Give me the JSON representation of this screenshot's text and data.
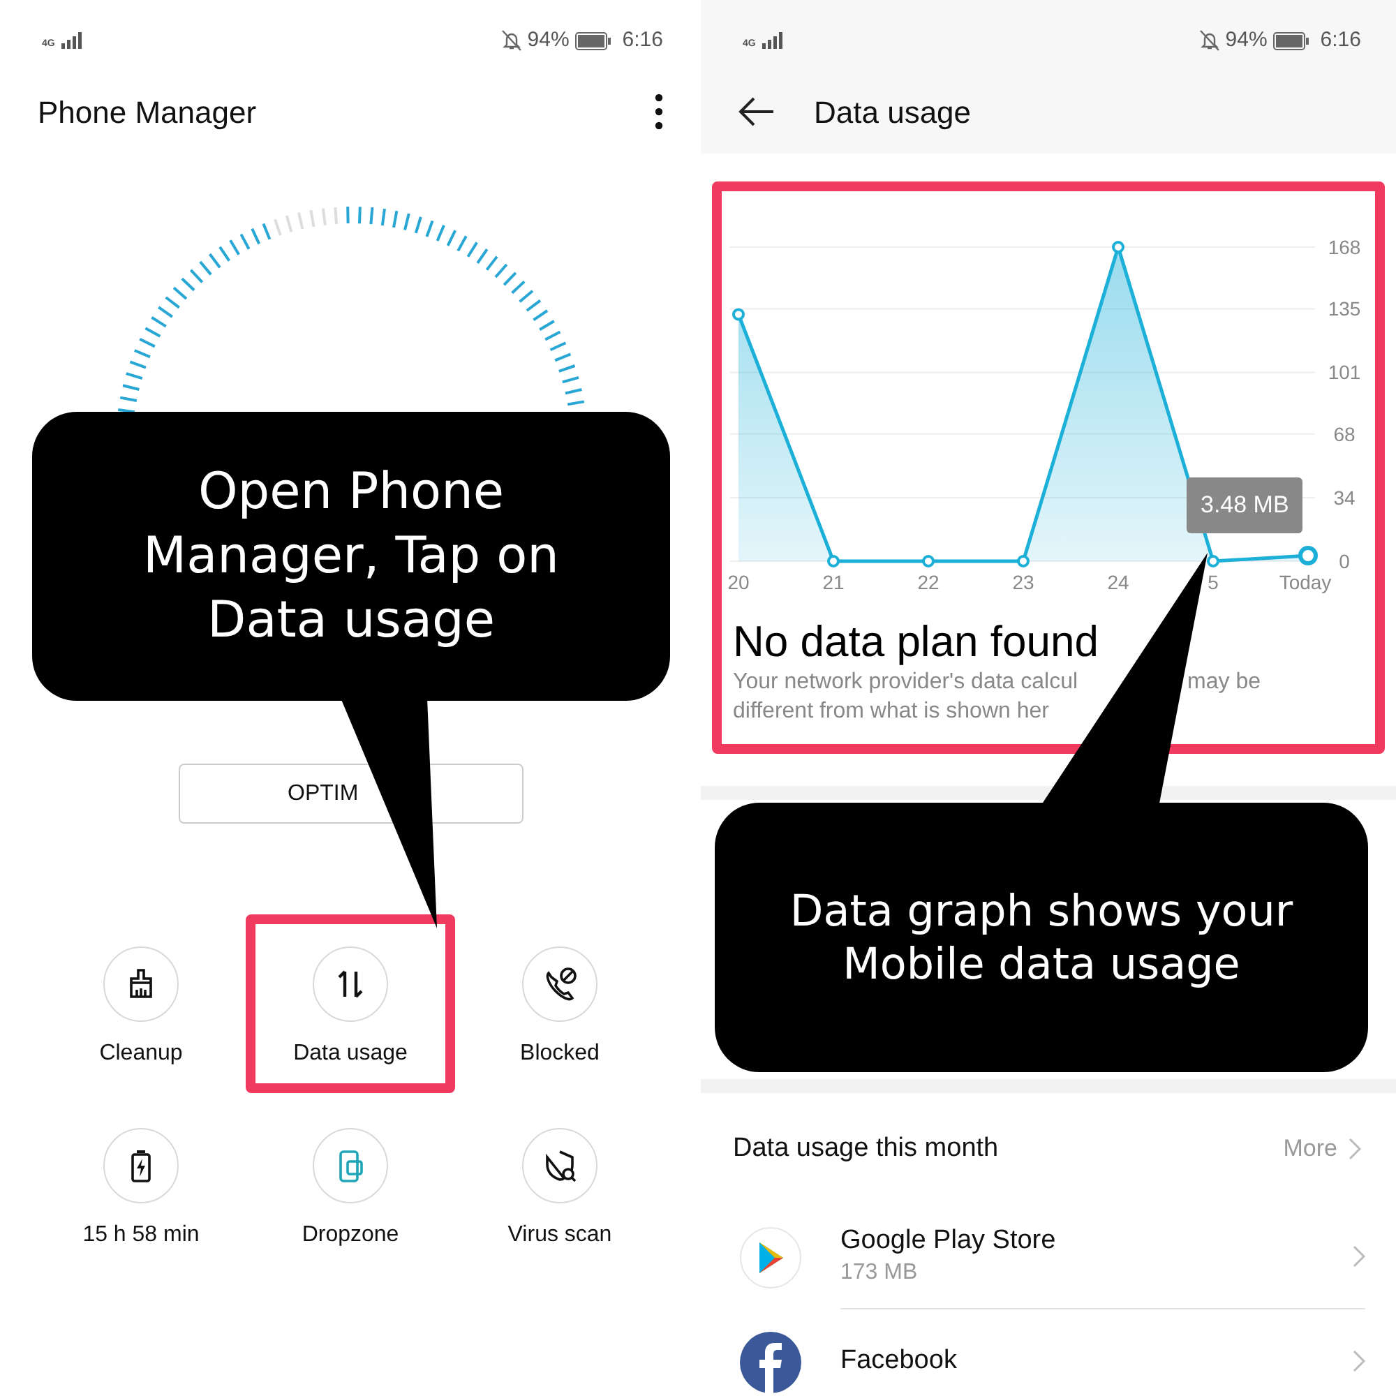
{
  "left_screen": {
    "status_bar": {
      "network": "4G",
      "battery": "94%",
      "time": "6:16"
    },
    "title": "Phone Manager",
    "optimize_button": "OPTIM",
    "tools": [
      {
        "label": "Cleanup",
        "kind": "cleanup",
        "highlighted": false
      },
      {
        "label": "Data usage",
        "kind": "data",
        "highlighted": true
      },
      {
        "label": "Blocked",
        "kind": "blocked",
        "highlighted": false
      },
      {
        "label": "15 h 58 min",
        "kind": "battery",
        "highlighted": false
      },
      {
        "label": "Dropzone",
        "kind": "dropzone",
        "highlighted": false
      },
      {
        "label": "Virus scan",
        "kind": "virus",
        "highlighted": false
      }
    ],
    "callout": "Open Phone Manager, Tap on Data usage"
  },
  "right_screen": {
    "status_bar": {
      "network": "4G",
      "battery": "94%",
      "time": "6:16"
    },
    "title": "Data usage",
    "chart_card": {
      "highlighted": true,
      "chart_data": {
        "type": "area",
        "grid": true,
        "categories": [
          "20",
          "21",
          "22",
          "23",
          "24",
          "5",
          "Today"
        ],
        "yticks": [
          0,
          34,
          68,
          101,
          135,
          168
        ],
        "ylim": [
          0,
          168
        ],
        "series": [
          {
            "color": "#1cb0d8",
            "values": [
              132,
              0,
              0,
              0,
              168,
              0,
              3
            ]
          }
        ]
      },
      "tooltip": "3.48 MB",
      "plan_title": "No data plan found",
      "plan_note": [
        {
          "left": "Your network provider's data calcul",
          "right": "may be"
        },
        {
          "left": "different from what is shown her"
        }
      ]
    },
    "callout": "Data graph shows your Mobile data usage",
    "month_section": {
      "title": "Data usage this month",
      "more": "More"
    },
    "apps": [
      {
        "name": "Google Play Store",
        "usage": "173 MB",
        "kind": "play"
      },
      {
        "name": "Facebook",
        "kind": "facebook"
      }
    ]
  }
}
